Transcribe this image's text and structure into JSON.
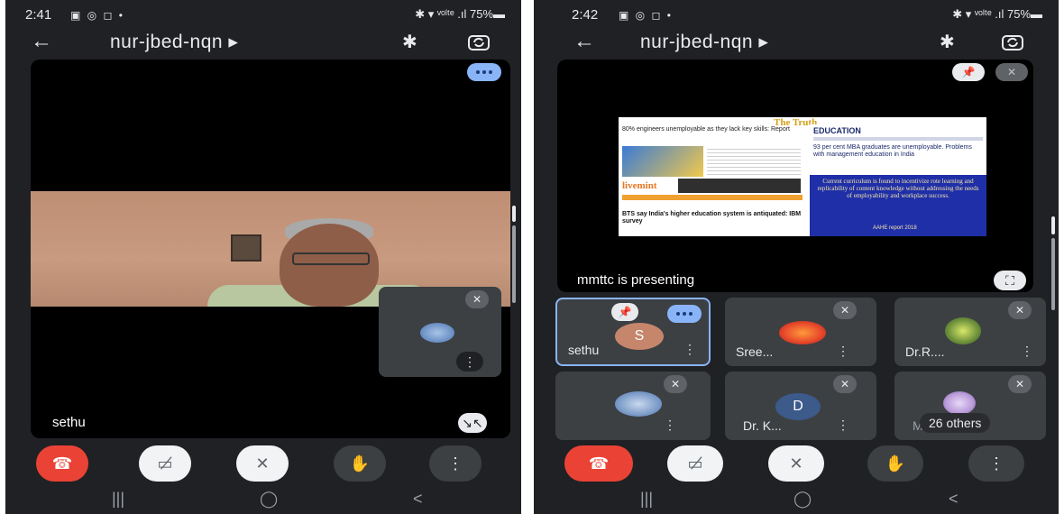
{
  "left": {
    "status": {
      "time": "2:41",
      "icons": "▣ ◎ ◻ •",
      "right": "✱ ▾ ᵛᵒˡᵗᵉ .ıl 75%▬"
    },
    "meeting_code": "nur-jbed-nqn ▸",
    "back_icon": "←",
    "bluetooth_icon": "✱",
    "main_tile_name": "sethu",
    "audio_pill": "audio-level-icon",
    "fullscreen_label": "↘↖",
    "mini_tile": {
      "mic_icon": "✕",
      "kebab": "⋮"
    },
    "controls": {
      "end": "☎",
      "camera": "▭̸",
      "mic": "✕",
      "hand": "✋",
      "more": "⋮"
    }
  },
  "right": {
    "status": {
      "time": "2:42",
      "icons": "▣ ◎ ◻ •",
      "right": "✱ ▾ ᵛᵒˡᵗᵉ .ıl 75%▬"
    },
    "meeting_code": "nur-jbed-nqn ▸",
    "presenting_text": "mmttc is presenting",
    "slide": {
      "heading": "The Truth",
      "headline1": "80% engineers unemployable as they lack key skills: Report",
      "brand_right": "EDUCATION",
      "right_text1": "93 per cent MBA graduates are unemployable. Problems with management education in India",
      "mint": "livemint",
      "ibm": "BTS say India's higher education system is antiquated: IBM survey",
      "blue_text": "Current curriculum is found to incentivize rote learning and replicability of content knowledge without addressing the needs of employability and workplace success.",
      "blue_footer": "AAHE report 2018"
    },
    "tiles": [
      {
        "name": "sethu",
        "letter": "S",
        "color": "#c5866c"
      },
      {
        "name": "Sree...",
        "letter": "",
        "color": "#e5452a"
      },
      {
        "name": "Dr.R....",
        "letter": "",
        "color": "#6b8f3a"
      },
      {
        "name": "",
        "letter": "",
        "color": "#4a74b0"
      },
      {
        "name": "Dr. K...",
        "letter": "D",
        "color": "#3c5a8a"
      },
      {
        "name": "M",
        "letter": "",
        "color": "#b89ad8"
      }
    ],
    "others_label": "26 others",
    "kebab": "⋮",
    "controls": {
      "end": "☎",
      "camera": "▭̸",
      "mic": "✕",
      "hand": "✋",
      "more": "⋮"
    }
  },
  "navbar": {
    "recents": "|||",
    "home": "◯",
    "back": "<"
  }
}
